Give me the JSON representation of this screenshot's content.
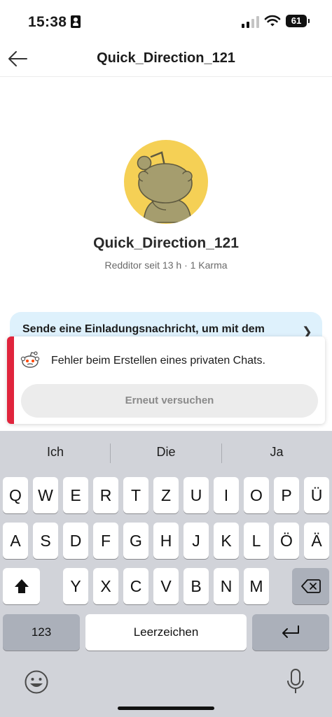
{
  "status_bar": {
    "time": "15:38",
    "battery": "61",
    "icons": [
      "person-id-icon",
      "cellular-signal-icon",
      "wifi-icon",
      "battery-icon"
    ]
  },
  "header": {
    "back_icon": "arrow-left-icon",
    "title": "Quick_Direction_121"
  },
  "profile": {
    "avatar_icon": "snoo-avatar-icon",
    "name": "Quick_Direction_121",
    "meta": "Redditor seit 13 h · 1 Karma"
  },
  "invite_banner": {
    "text": "Sende eine Einladungsnachricht, um mit dem"
  },
  "error_toast": {
    "icon": "snoo-error-icon",
    "message": "Fehler beim Erstellen eines privaten Chats.",
    "retry_label": "Erneut versuchen",
    "accent_color": "#e0243c"
  },
  "keyboard": {
    "suggestions": [
      "Ich",
      "Die",
      "Ja"
    ],
    "row1": [
      "Q",
      "W",
      "E",
      "R",
      "T",
      "Z",
      "U",
      "I",
      "O",
      "P",
      "Ü"
    ],
    "row2": [
      "A",
      "S",
      "D",
      "F",
      "G",
      "H",
      "J",
      "K",
      "L",
      "Ö",
      "Ä"
    ],
    "row3": [
      "Y",
      "X",
      "C",
      "V",
      "B",
      "N",
      "M"
    ],
    "numbers_label": "123",
    "space_label": "Leerzeichen",
    "shift_icon": "shift-icon",
    "delete_icon": "backspace-icon",
    "return_icon": "return-icon",
    "emoji_icon": "emoji-icon",
    "mic_icon": "microphone-icon"
  }
}
